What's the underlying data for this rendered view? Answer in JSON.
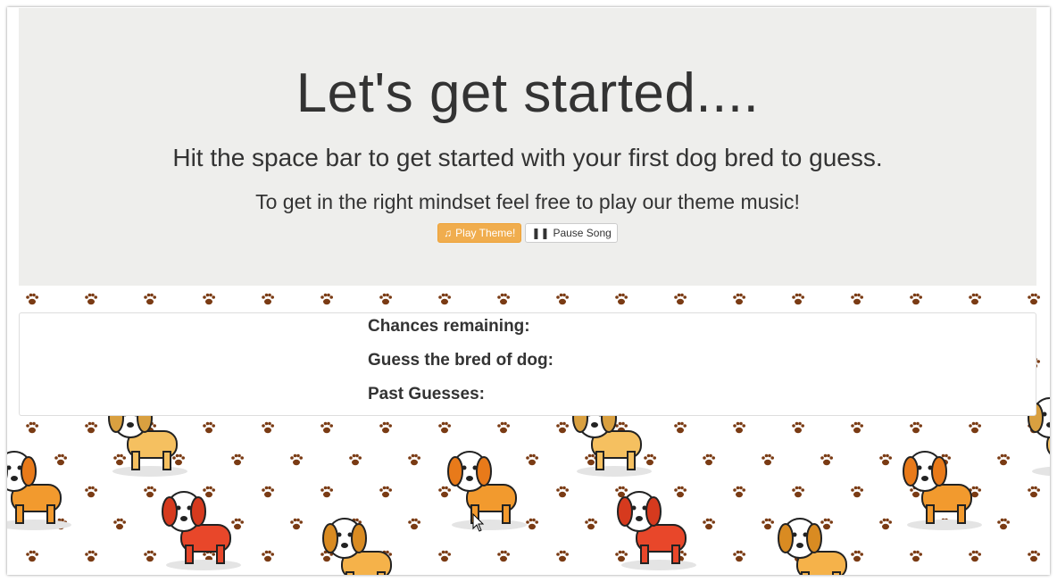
{
  "jumbotron": {
    "title": "Let's get started....",
    "lead": "Hit the space bar to get started with your first dog bred to guess.",
    "music_prompt": "To get in the right mindset feel free to play our theme music!",
    "play_button": "Play Theme!",
    "pause_button": "Pause Song"
  },
  "game_panel": {
    "chances_label": "Chances remaining:",
    "guess_label": "Guess the bred of dog:",
    "past_label": "Past Guesses:"
  },
  "colors": {
    "jumbotron_bg": "#eeeeec",
    "play_button_bg": "#f0ad4e",
    "paw_color": "#7a3b14"
  },
  "icons": {
    "play": "music-note-icon",
    "pause": "pause-icon"
  }
}
